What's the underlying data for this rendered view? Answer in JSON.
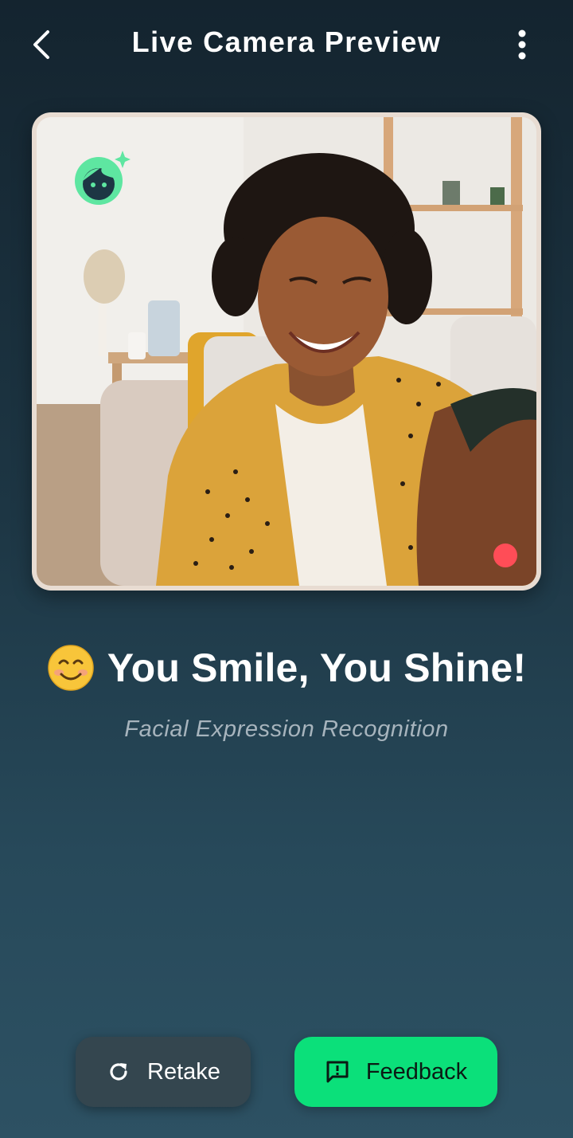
{
  "header": {
    "title": "Live Camera Preview",
    "back_icon": "chevron-left-icon",
    "menu_icon": "more-vert-icon"
  },
  "preview": {
    "badge_icon": "face-sparkle-icon",
    "recording_indicator": "record-dot",
    "colors": {
      "badge": "#5ee6a1",
      "record": "#ff4d57",
      "frame": "#e8dcd2"
    }
  },
  "result": {
    "emoji": "smiling-face-emoji",
    "text": "You Smile, You Shine!",
    "subtitle": "Facial Expression Recognition"
  },
  "actions": {
    "retake": {
      "label": "Retake",
      "icon": "refresh-icon",
      "color": "#34464f"
    },
    "feedback": {
      "label": "Feedback",
      "icon": "feedback-message-icon",
      "color": "#0be07a"
    }
  }
}
